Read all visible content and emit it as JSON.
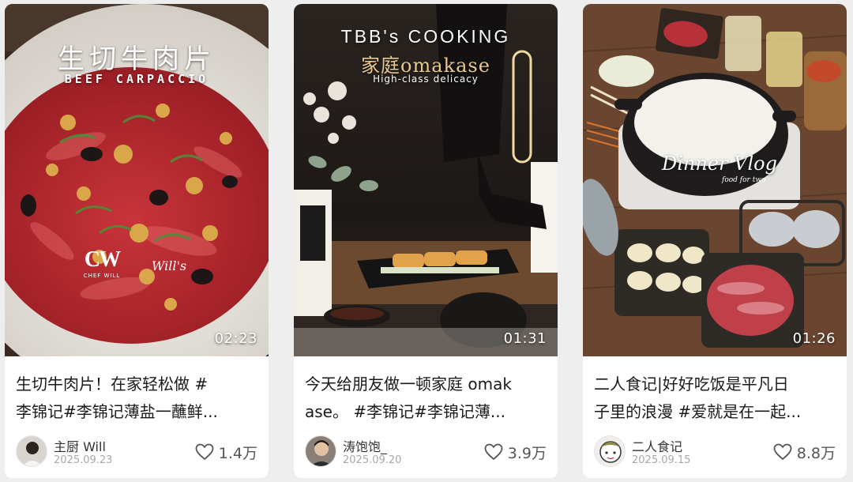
{
  "cards": [
    {
      "cover": {
        "title_cn": "生切牛肉片",
        "title_en": "BEEF CARPACCIO",
        "logo": "CW",
        "logo_sub": "CHEF WILL",
        "signature": "Will's",
        "duration": "02:23"
      },
      "title_lines": [
        "生切牛肉片！在家轻松做 #",
        "李锦记#李锦记薄盐一蘸鲜..."
      ],
      "author": "主厨 Will",
      "date": "2025.09.23",
      "likes": "1.4万"
    },
    {
      "cover": {
        "brand": "TBB's COOKING",
        "title": "家庭omakase",
        "subtitle": "High-class delicacy",
        "duration": "01:31"
      },
      "title_lines": [
        "今天给朋友做一顿家庭 omak",
        "ase。 #李锦记#李锦记薄..."
      ],
      "author": "涛饱饱_",
      "date": "2025.09.20",
      "likes": "3.9万"
    },
    {
      "cover": {
        "title": "Dinner Vlog",
        "subtitle": "food for two",
        "duration": "01:26"
      },
      "title_lines": [
        "二人食记|好好吃饭是平凡日",
        "子里的浪漫 #爱就是在一起..."
      ],
      "author": "二人食记",
      "date": "2025.09.15",
      "likes": "8.8万"
    }
  ],
  "icons": {
    "like": "heart-outline-icon",
    "avatar": "user-avatar"
  },
  "colors": {
    "page_bg": "#eeeeee",
    "card_bg": "#ffffff",
    "title_text": "#1a1a1a",
    "meta_text": "#a8a8a8"
  }
}
